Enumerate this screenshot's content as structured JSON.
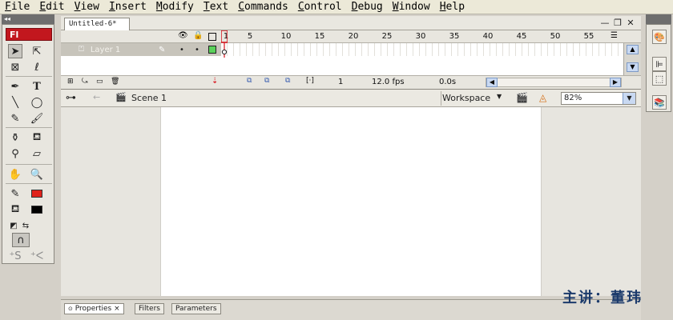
{
  "menu": [
    {
      "key": "F",
      "rest": "ile"
    },
    {
      "key": "E",
      "rest": "dit"
    },
    {
      "key": "V",
      "rest": "iew"
    },
    {
      "key": "I",
      "rest": "nsert"
    },
    {
      "key": "M",
      "rest": "odify"
    },
    {
      "key": "T",
      "rest": "ext"
    },
    {
      "key": "C",
      "rest": "ommands"
    },
    {
      "key": "C",
      "rest": "ontrol"
    },
    {
      "key": "D",
      "rest": "ebug"
    },
    {
      "key": "W",
      "rest": "indow"
    },
    {
      "key": "H",
      "rest": "elp"
    }
  ],
  "tools": {
    "logo": "Fl",
    "stroke_color": "#e0221b",
    "fill_color": "#000000"
  },
  "document": {
    "tab": "Untitled-6*"
  },
  "timeline": {
    "frame_numbers": [
      "1",
      "5",
      "10",
      "15",
      "20",
      "25",
      "30",
      "35",
      "40",
      "45",
      "50",
      "55"
    ],
    "layer_name": "Layer 1",
    "current_frame": "1",
    "frame_rate": "12.0 fps",
    "elapsed": "0.0s"
  },
  "editbar": {
    "scene": "Scene 1",
    "workspace": "Workspace",
    "zoom": "82%"
  },
  "panels": {
    "properties": "Properties",
    "filters": "Filters",
    "parameters": "Parameters"
  },
  "watermark": "主讲：董玮"
}
